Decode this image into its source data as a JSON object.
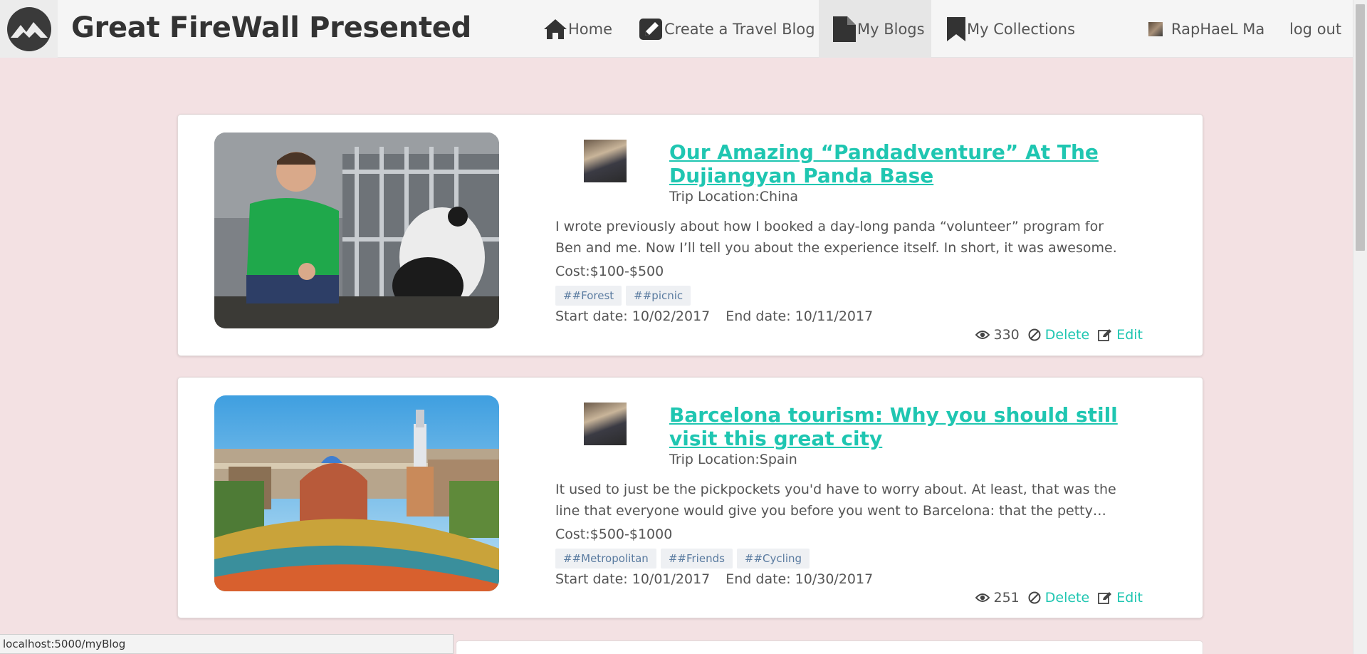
{
  "nav": {
    "brand": "Great FireWall Presented",
    "home": "Home",
    "create": "Create a Travel Blog",
    "my_blogs": "My Blogs",
    "my_collections": "My Collections",
    "user": "RapHaeL Ma",
    "logout": "log out"
  },
  "blogs": [
    {
      "title": "Our Amazing “Pandadventure” At The Dujiangyan Panda Base",
      "location": "Trip Location:China",
      "excerpt": "I wrote previously about how I booked a day-long panda “volunteer” program for Ben and me. Now I’ll tell you about the experience itself. In short, it was awesome.",
      "cost": "Cost:$100-$500",
      "tags": [
        "##Forest",
        "##picnic"
      ],
      "start": "Start date: 10/02/2017",
      "end": "End date: 10/11/2017",
      "views": "330",
      "delete": "Delete",
      "edit": "Edit"
    },
    {
      "title": "Barcelona tourism: Why you should still visit this great city",
      "location": "Trip Location:Spain",
      "excerpt": "It used to just be the pickpockets you'd have to worry about. At least, that was the line that everyone would give you before you went to Barcelona: that the petty crime was the only thing to watch.",
      "cost": "Cost:$500-$1000",
      "tags": [
        "##Metropolitan",
        "##Friends",
        "##Cycling"
      ],
      "start": "Start date: 10/01/2017",
      "end": "End date: 10/30/2017",
      "views": "251",
      "delete": "Delete",
      "edit": "Edit"
    }
  ],
  "status_url": "localhost:5000/myBlog",
  "colors": {
    "accent": "#1fc6b1",
    "background": "#f3e1e3"
  }
}
